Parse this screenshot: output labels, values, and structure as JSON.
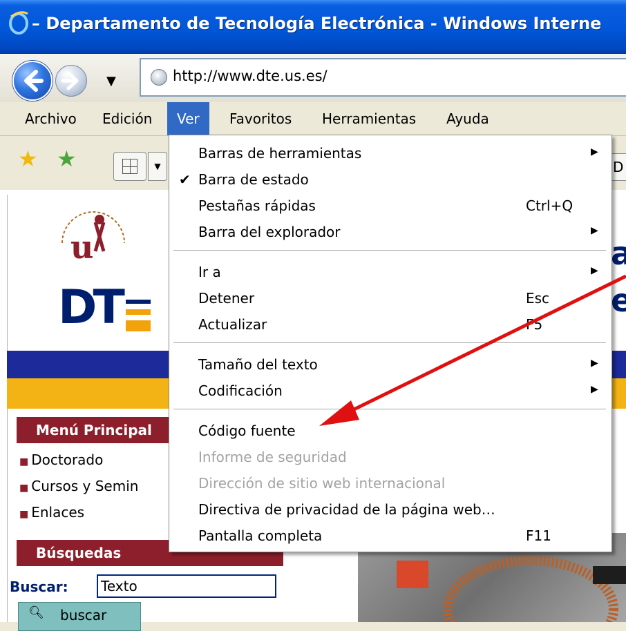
{
  "window": {
    "title": "– Departamento de Tecnología Electrónica - Windows Interne"
  },
  "address": {
    "url": "http://www.dte.us.es/"
  },
  "menubar": [
    "Archivo",
    "Edición",
    "Ver",
    "Favoritos",
    "Herramientas",
    "Ayuda"
  ],
  "toolbar": {
    "tab_cut_label": "D"
  },
  "view_menu": {
    "toolbars": "Barras de herramientas",
    "status_bar": "Barra de estado",
    "quick_tabs": "Pestañas rápidas",
    "quick_tabs_shortcut": "Ctrl+Q",
    "explorer_bar": "Barra del explorador",
    "go_to": "Ir a",
    "stop": "Detener",
    "stop_shortcut": "Esc",
    "refresh": "Actualizar",
    "refresh_shortcut": "F5",
    "text_size": "Tamaño del texto",
    "encoding": "Codificación",
    "source": "Código fuente",
    "security_report": "Informe de seguridad",
    "intl_address": "Dirección de sitio web internacional",
    "privacy_policy": "Directiva de privacidad de la página web…",
    "full_screen": "Pantalla completa",
    "full_screen_shortcut": "F11"
  },
  "page": {
    "logo_text": "DT",
    "menu_heading": "Menú Principal",
    "links": [
      "Doctorado",
      "Cursos y Semin",
      "Enlaces"
    ],
    "search_heading": "Búsquedas",
    "search_label": "Buscar:",
    "search_value": "Texto",
    "search_button": "buscar",
    "right_hint1": "a",
    "right_hint2": "e"
  },
  "colors": {
    "accent": "#316ac5",
    "brand_red": "#8c1f2b",
    "brand_blue": "#1c2a9a",
    "brand_yellow": "#f3b314",
    "arrow": "#e01010"
  }
}
